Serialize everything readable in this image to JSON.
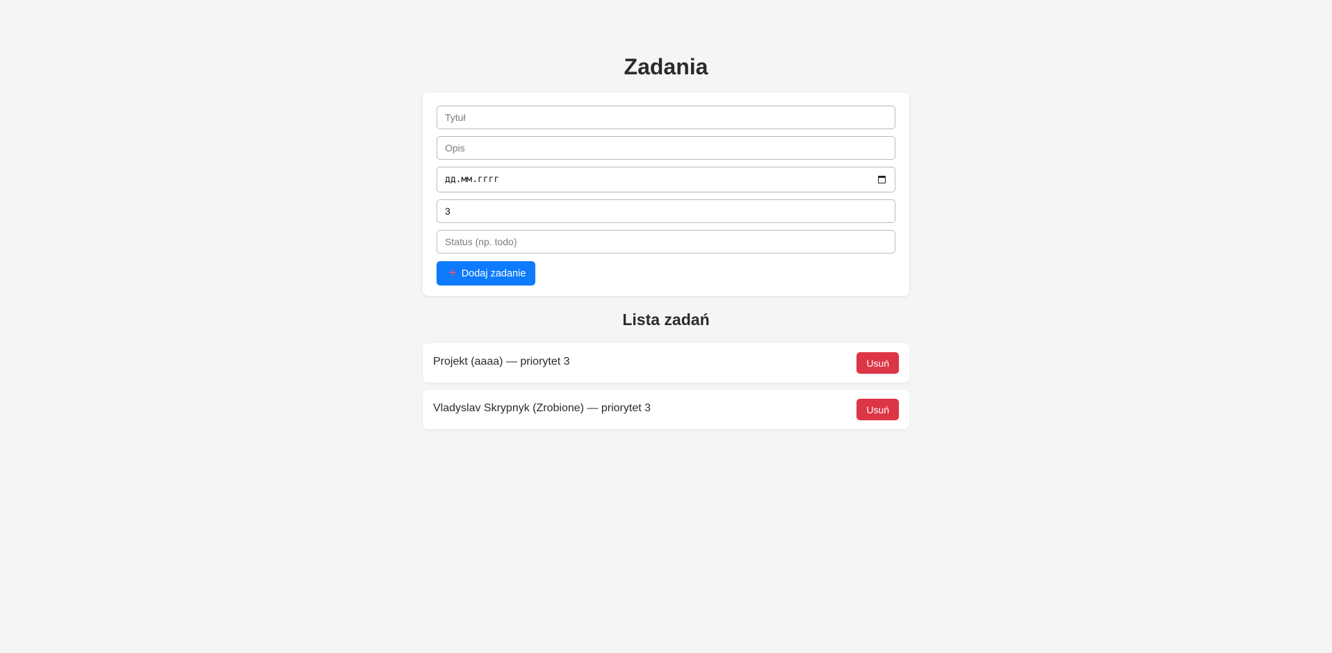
{
  "page": {
    "title": "Zadania"
  },
  "form": {
    "title_placeholder": "Tytuł",
    "description_placeholder": "Opis",
    "date_placeholder": "дд.мм.гггг",
    "priority_value": "3",
    "status_placeholder": "Status (np. todo)",
    "add_button_label": "Dodaj zadanie",
    "add_icon": "plus-icon",
    "date_icon": "calendar-icon"
  },
  "list": {
    "title": "Lista zadań",
    "items": [
      {
        "text": "Projekt (aaaa) — priorytet 3",
        "delete_label": "Usuń"
      },
      {
        "text": "Vladyslav Skrypnyk (Zrobione) — priorytet 3",
        "delete_label": "Usuń"
      }
    ]
  },
  "colors": {
    "background": "#f4f5f7",
    "primary_button": "#0d7bfb",
    "delete_button": "#dc3545",
    "plus_icon": "#ff4d6d"
  }
}
